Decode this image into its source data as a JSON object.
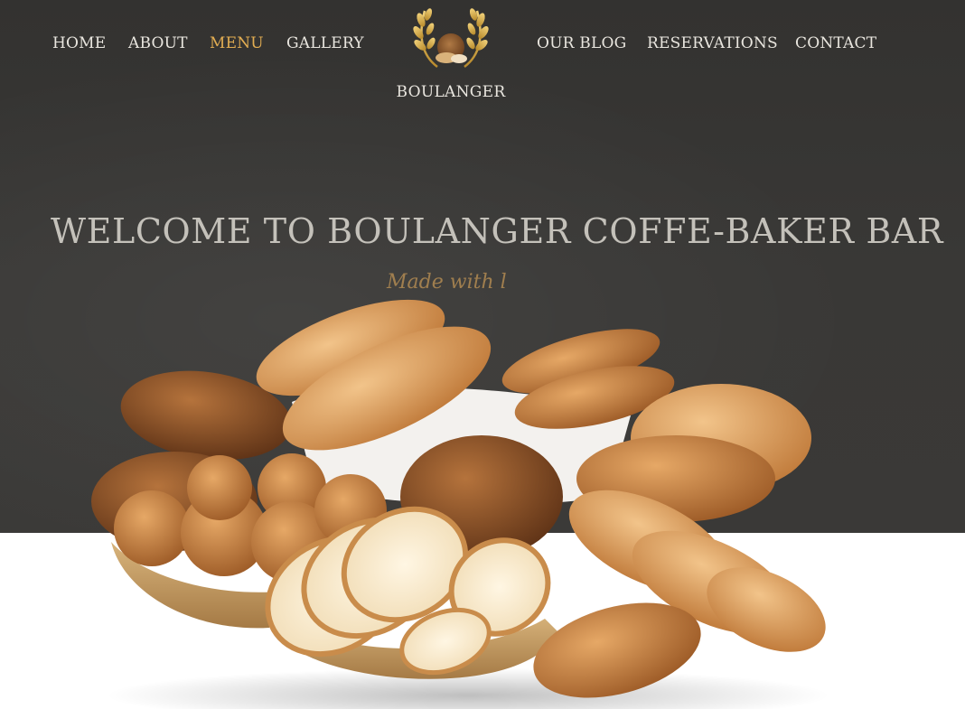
{
  "nav": {
    "left": [
      {
        "label": "HOME",
        "active": false
      },
      {
        "label": "ABOUT",
        "active": false
      },
      {
        "label": "MENU",
        "active": true
      },
      {
        "label": "GALLERY",
        "active": false
      }
    ],
    "right": [
      {
        "label": "OUR BLOG",
        "active": false
      },
      {
        "label": "RESERVATIONS",
        "active": false
      },
      {
        "label": "CONTACT",
        "active": false
      }
    ]
  },
  "logo": {
    "name": "BOULANGER",
    "icon": "wheat-wreath-icon"
  },
  "hero": {
    "title": "WELCOME TO BOULANGER COFFE-BAKER BAR",
    "script": "Made with l"
  },
  "colors": {
    "accent": "#e2ad52",
    "hero_bg": "#373634",
    "nav_text": "#e9e6df",
    "title_text": "#c4c1ba"
  }
}
